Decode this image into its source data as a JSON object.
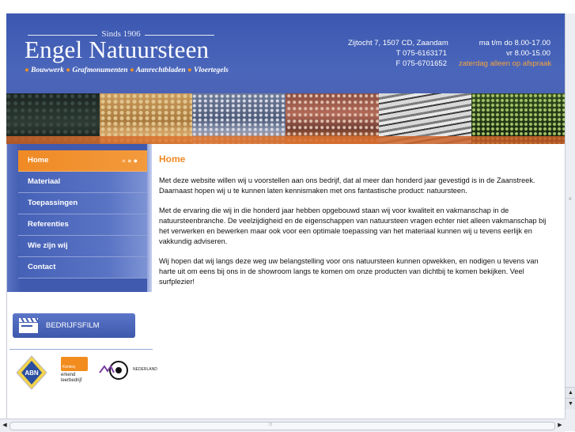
{
  "header": {
    "since": "Sinds 1906",
    "brand": "Engel Natuursteen",
    "tagline_items": [
      "Bouwwerk",
      "Grafmonumenten",
      "Aanrechtbladen",
      "Vloertegels"
    ],
    "address": "Zijtocht 7, 1507 CD, Zaandam",
    "phone": "T 075-6163171",
    "fax": "F 075-6701652",
    "hours_weekday": "ma t/m do 8.00-17.00",
    "hours_friday": "vr 8.00-15.00",
    "hours_saturday": "zaterdag alleen op afspraak"
  },
  "nav": {
    "items": [
      {
        "label": "Home",
        "active": true
      },
      {
        "label": "Materiaal",
        "active": false
      },
      {
        "label": "Toepassingen",
        "active": false
      },
      {
        "label": "Referenties",
        "active": false
      },
      {
        "label": "Wie zijn wij",
        "active": false
      },
      {
        "label": "Contact",
        "active": false
      }
    ]
  },
  "sidebar": {
    "film_button": "BEDRIJFSFILM",
    "logos": {
      "abn": "ABN",
      "erkend_top": "Kenteq",
      "erkend_line1": "erkend",
      "erkend_line2": "leerbedrijf",
      "mbo_text": "NEDERLAND"
    }
  },
  "content": {
    "title": "Home",
    "paragraphs": [
      "Met deze website willen wij u voorstellen aan ons bedrijf, dat al meer dan honderd jaar gevestigd is in de Zaanstreek. Daarnaast hopen wij u te kunnen laten kennismaken met ons fantastische product: natuursteen.",
      "Met de ervaring die wij in die honderd jaar hebben opgebouwd staan wij voor kwaliteit en vakmanschap in de natuursteenbranche. De veelzijdigheid en de eigenschappen van natuursteen vragen echter niet alleen vakmanschap bij het verwerken en bewerken maar ook voor een optimale toepassing van het materiaal kunnen wij u tevens eerlijk en vakkundig adviseren.",
      "Wij hopen dat wij langs deze weg uw belangstelling voor ons natuursteen kunnen opwekken, en nodigen u tevens van harte uit om eens bij ons in de showroom langs te komen om onze producten van dichtbij te komen bekijken. Veel surfplezier!"
    ]
  },
  "colors": {
    "header_blue": "#4a66bb",
    "accent_orange": "#f08a25"
  },
  "icons": [
    "film-clapper-icon",
    "scroll-up-icon",
    "scroll-down-icon",
    "scroll-left-icon",
    "scroll-right-icon"
  ]
}
